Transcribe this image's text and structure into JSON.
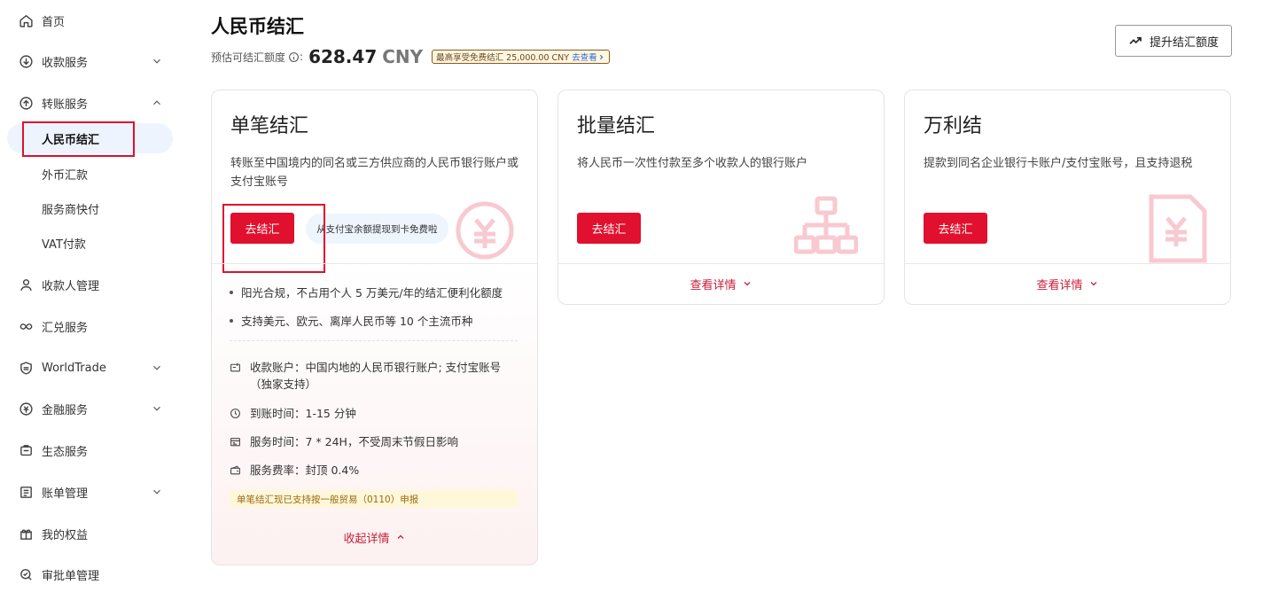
{
  "sidebar": {
    "items": [
      {
        "label": "首页",
        "icon": "home-icon"
      },
      {
        "label": "收款服务",
        "icon": "download-circle-icon"
      },
      {
        "label": "转账服务",
        "icon": "upload-circle-icon"
      },
      {
        "label": "收款人管理",
        "icon": "person-icon"
      },
      {
        "label": "汇兑服务",
        "icon": "exchange-icon"
      },
      {
        "label": "WorldTrade",
        "icon": "shield-icon"
      },
      {
        "label": "金融服务",
        "icon": "finance-icon"
      },
      {
        "label": "生态服务",
        "icon": "ecosystem-icon"
      },
      {
        "label": "账单管理",
        "icon": "bill-icon"
      },
      {
        "label": "我的权益",
        "icon": "gift-icon"
      },
      {
        "label": "审批单管理",
        "icon": "approval-icon"
      }
    ],
    "sub_items": [
      {
        "label": "人民币结汇"
      },
      {
        "label": "外币汇款"
      },
      {
        "label": "服务商快付"
      },
      {
        "label": "VAT付款"
      }
    ]
  },
  "header": {
    "title": "人民币结汇",
    "quota_label": "预估可结汇额度",
    "quota_colon": ":",
    "quota_amount": "628.47",
    "quota_unit": "CNY",
    "free_badge_text": "最高享受免费结汇 25,000.00 CNY",
    "free_badge_link": "去查看",
    "raise_button": "提升结汇额度"
  },
  "cards": {
    "single": {
      "title": "单笔结汇",
      "desc": "转账至中国境内的同名或三方供应商的人民币银行账户或支付宝账号",
      "button": "去结汇",
      "pill": "从支付宝余额提现到卡免费啦",
      "bullets": [
        "阳光合规，不占用个人 5 万美元/年的结汇便利化额度",
        "支持美元、欧元、离岸人民币等 10 个主流币种"
      ],
      "info": [
        {
          "text": "收款账户：中国内地的人民币银行账户; 支付宝账号（独家支持）",
          "icon": "account-icon"
        },
        {
          "text": "到账时间：1-15 分钟",
          "icon": "clock-icon"
        },
        {
          "text": "服务时间：7 * 24H，不受周末节假日影响",
          "icon": "calendar-icon"
        },
        {
          "text": "服务费率：封顶 0.4%",
          "icon": "wallet-icon"
        }
      ],
      "notice": "单笔结汇现已支持按一般贸易（0110）申报",
      "collapse": "收起详情"
    },
    "batch": {
      "title": "批量结汇",
      "desc": "将人民币一次性付款至多个收款人的银行账户",
      "button": "去结汇",
      "details": "查看详情"
    },
    "wanlijie": {
      "title": "万利结",
      "desc": "提款到同名企业银行卡账户/支付宝账号，且支持退税",
      "button": "去结汇",
      "details": "查看详情"
    }
  },
  "colors": {
    "accent": "#e0102e",
    "link_red": "#c8203a",
    "active_bg": "#eef4fd"
  }
}
